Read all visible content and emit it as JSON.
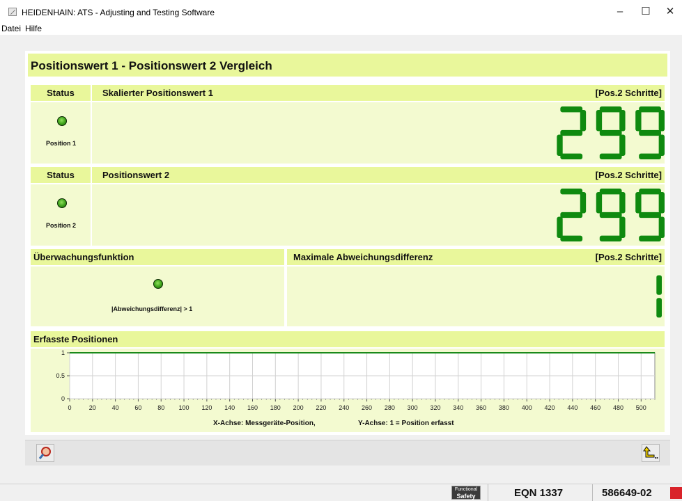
{
  "window": {
    "title": "HEIDENHAIN: ATS - Adjusting and Testing Software",
    "minimize": "–",
    "maximize": "☐",
    "close": "✕"
  },
  "menu": {
    "items": [
      "Datei",
      "Hilfe"
    ]
  },
  "panel": {
    "title": "Positionswert 1 - Positionswert 2 Vergleich",
    "section1": {
      "status_label": "Status",
      "header": "Skalierter Positionswert 1",
      "unit": "[Pos.2 Schritte]",
      "led_label": "Position 1",
      "value": "299"
    },
    "section2": {
      "status_label": "Status",
      "header": "Positionswert 2",
      "unit": "[Pos.2 Schritte]",
      "led_label": "Position 2",
      "value": "299"
    },
    "section3": {
      "left_header": "Überwachungsfunktion",
      "led_label": "|Abweichungsdifferenz| > 1",
      "right_header": "Maximale Abweichungsdifferenz",
      "unit": "[Pos.2 Schritte]",
      "value": "1"
    },
    "section4": {
      "header": "Erfasste Positionen"
    }
  },
  "chart_data": {
    "type": "line",
    "title": "",
    "xlabel": "X-Achse: Messgeräte-Position,",
    "ylabel": "Y-Achse: 1 = Position erfasst",
    "xlim": [
      0,
      512
    ],
    "ylim": [
      0,
      1
    ],
    "x_ticks": [
      0,
      20,
      40,
      60,
      80,
      100,
      120,
      140,
      160,
      180,
      200,
      220,
      240,
      260,
      280,
      300,
      320,
      340,
      360,
      380,
      400,
      420,
      440,
      460,
      480,
      500
    ],
    "y_ticks": [
      0,
      0.5,
      1
    ],
    "grid": true,
    "series": [
      {
        "x": [
          0,
          512
        ],
        "values": [
          1,
          1
        ],
        "color": "#1a8a1a"
      }
    ]
  },
  "buttons": {
    "zoom": "zoom-icon",
    "back": "return-icon"
  },
  "statusbar": {
    "badge_top": "Functional",
    "badge_bottom": "Safety",
    "device": "EQN 1337",
    "id": "586649-02"
  },
  "colors": {
    "header": "#e9f79b",
    "body": "#f3fad0",
    "segment_on": "#0f8a0f",
    "led": "#3ca01a"
  }
}
